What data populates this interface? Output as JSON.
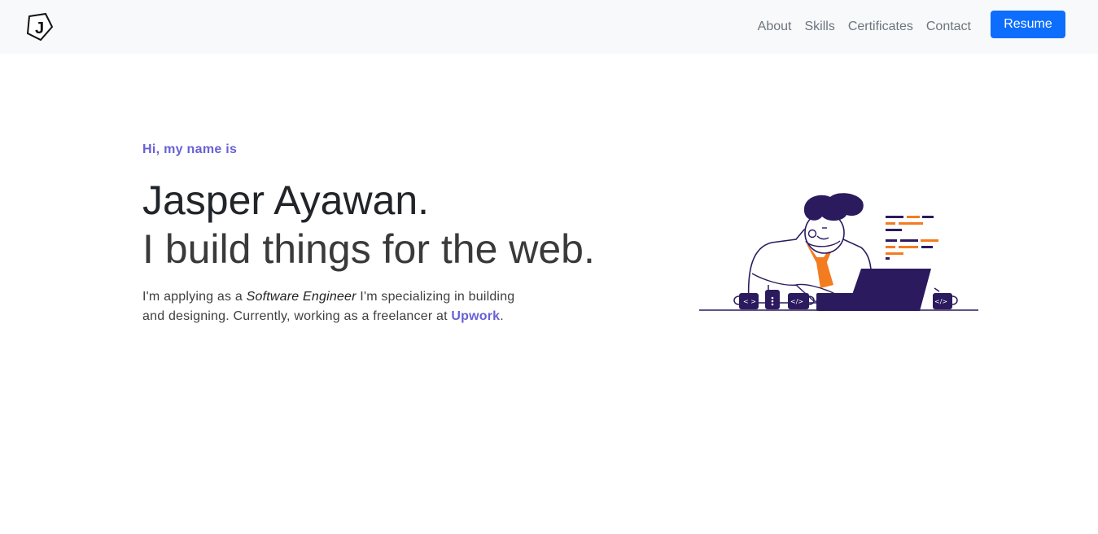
{
  "nav": {
    "logo_letter": "J",
    "links": [
      "About",
      "Skills",
      "Certificates",
      "Contact"
    ],
    "resume_label": "Resume"
  },
  "hero": {
    "greeting": "Hi, my name is",
    "name": "Jasper Ayawan.",
    "tagline": "I build things for the web.",
    "intro_before": "I'm applying as a ",
    "intro_role": "Software Engineer",
    "intro_middle": " I'm specializing in building and designing. Currently, working as a freelancer at ",
    "intro_link": "Upwork",
    "intro_end": "."
  },
  "illustration": {
    "icon_names": [
      "developer-illustration",
      "coffee-mug-icon",
      "code-mug-icon",
      "laptop-icon",
      "code-lines-icon"
    ],
    "mug_labels": [
      "< >",
      "</>",
      "</>"
    ]
  },
  "colors": {
    "accent": "#6861d6",
    "primary_button": "#0d6efd",
    "navbar_bg": "#f8f9fa",
    "illustration_navy": "#2b1a5e",
    "illustration_orange": "#f47c20"
  }
}
